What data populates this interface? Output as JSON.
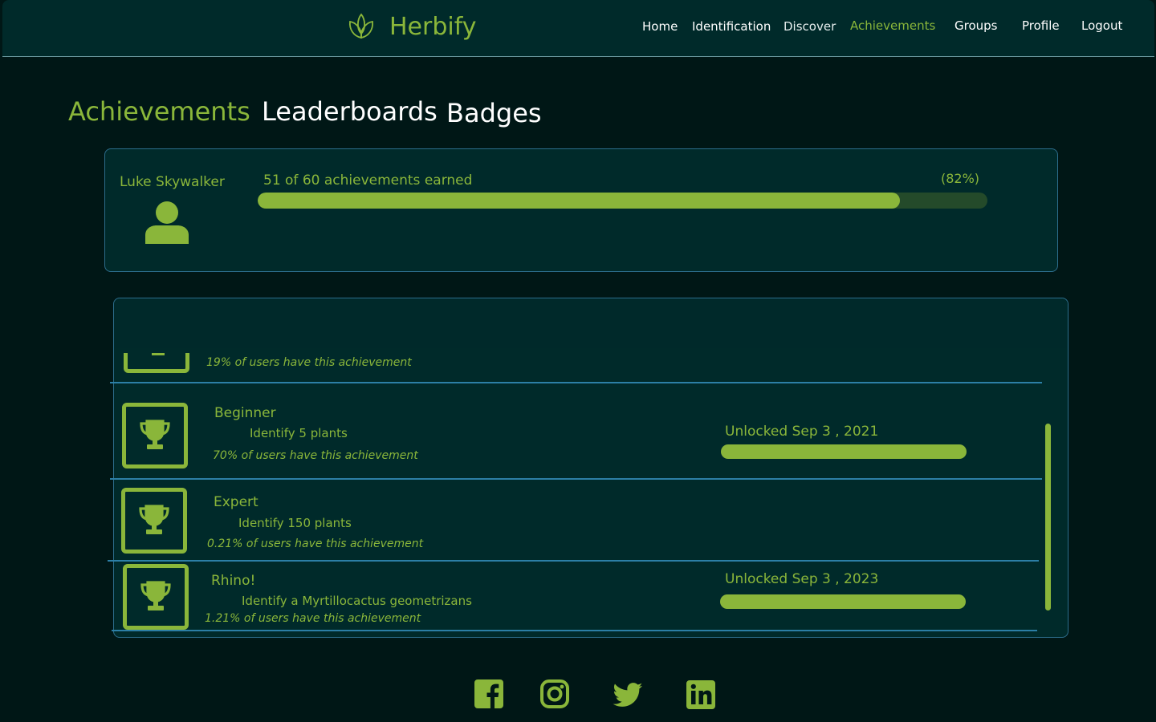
{
  "brand": {
    "name": "Herbify",
    "logo_icon": "leaf-logo-icon"
  },
  "nav": {
    "home": "Home",
    "identification": "Identification",
    "discover": "Discover",
    "achievements": "Achievements",
    "groups": "Groups",
    "profile": "Profile",
    "logout": "Logout"
  },
  "tabs": {
    "achievements": "Achievements",
    "leaderboards": "Leaderboards",
    "badges": "Badges"
  },
  "summary": {
    "user_name": "Luke Skywalker",
    "avatar_icon": "user-icon",
    "progress_text": "51 of 60 achievements earned",
    "percent_text": "(82%)",
    "progress_fraction": 0.88
  },
  "achievements": [
    {
      "title": "",
      "description": "",
      "stat": "19% of users have this achievement",
      "unlocked": ""
    },
    {
      "title": "Beginner",
      "description": "Identify 5 plants",
      "stat": "70% of users have this achievement",
      "unlocked": "Unlocked Sep 3 , 2021"
    },
    {
      "title": "Expert",
      "description": "Identify 150 plants",
      "stat": "0.21% of users have this achievement",
      "unlocked": ""
    },
    {
      "title": "Rhino!",
      "description": "Identify a Myrtillocactus geometrizans",
      "stat": "1.21% of users have this achievement",
      "unlocked": "Unlocked Sep 3 , 2023"
    }
  ],
  "icons": {
    "achievement": "trophy-icon"
  },
  "social": [
    "facebook-icon",
    "instagram-icon",
    "twitter-icon",
    "linkedin-icon"
  ],
  "colors": {
    "accent": "#8ab63a",
    "background": "#001716",
    "panel": "#002a2a",
    "border": "#2c6d8c"
  }
}
